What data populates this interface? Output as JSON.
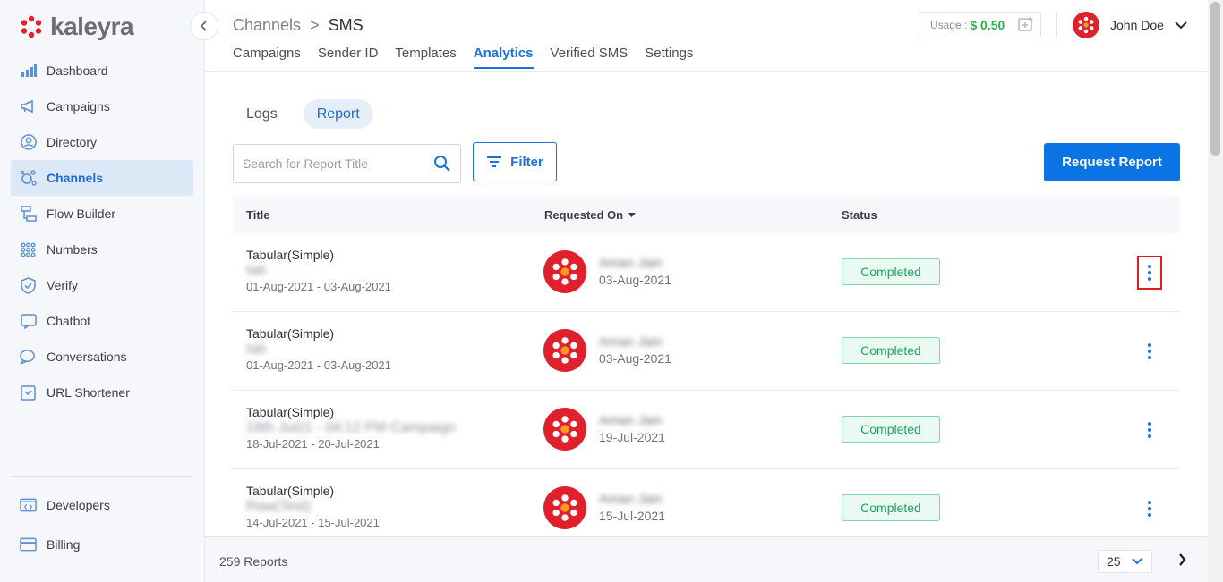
{
  "app": {
    "logo_text": "kaleyra"
  },
  "sidebar": {
    "items": [
      {
        "label": "Dashboard",
        "icon": "bar-chart-icon"
      },
      {
        "label": "Campaigns",
        "icon": "megaphone-icon"
      },
      {
        "label": "Directory",
        "icon": "contact-icon"
      },
      {
        "label": "Channels",
        "icon": "channels-icon",
        "active": true
      },
      {
        "label": "Flow Builder",
        "icon": "flow-icon"
      },
      {
        "label": "Numbers",
        "icon": "numbers-grid-icon"
      },
      {
        "label": "Verify",
        "icon": "shield-check-icon"
      },
      {
        "label": "Chatbot",
        "icon": "chatbot-icon"
      },
      {
        "label": "Conversations",
        "icon": "chat-bubbles-icon"
      },
      {
        "label": "URL Shortener",
        "icon": "link-icon"
      }
    ],
    "bottom_items": [
      {
        "label": "Developers",
        "icon": "code-icon"
      },
      {
        "label": "Billing",
        "icon": "card-icon"
      }
    ]
  },
  "header": {
    "breadcrumb": {
      "parent": "Channels",
      "separator": ">",
      "current": "SMS"
    },
    "tabs": [
      {
        "label": "Campaigns"
      },
      {
        "label": "Sender ID"
      },
      {
        "label": "Templates"
      },
      {
        "label": "Analytics",
        "active": true
      },
      {
        "label": "Verified SMS"
      },
      {
        "label": "Settings"
      }
    ],
    "usage": {
      "label": "Usage :",
      "amount": "$ 0.50"
    },
    "user": {
      "name": "John Doe"
    }
  },
  "subtabs": [
    {
      "label": "Logs"
    },
    {
      "label": "Report",
      "active": true
    }
  ],
  "search": {
    "placeholder": "Search for Report Title"
  },
  "filter_label": "Filter",
  "request_report_label": "Request Report",
  "table": {
    "columns": {
      "title": "Title",
      "requested_on": "Requested On",
      "status": "Status"
    },
    "rows": [
      {
        "type": "Tabular(Simple)",
        "name": "tab",
        "range": "01-Aug-2021 - 03-Aug-2021",
        "requester": "Aman Jain",
        "date": "03-Aug-2021",
        "status": "Completed"
      },
      {
        "type": "Tabular(Simple)",
        "name": "tab",
        "range": "01-Aug-2021 - 03-Aug-2021",
        "requester": "Aman Jain",
        "date": "03-Aug-2021",
        "status": "Completed"
      },
      {
        "type": "Tabular(Simple)",
        "name": "19th Jul21 - 04:12 PM Campaign",
        "range": "18-Jul-2021 - 20-Jul-2021",
        "requester": "Aman Jain",
        "date": "19-Jul-2021",
        "status": "Completed"
      },
      {
        "type": "Tabular(Simple)",
        "name": "Raw(Test)",
        "range": "14-Jul-2021 - 15-Jul-2021",
        "requester": "Aman Jain",
        "date": "15-Jul-2021",
        "status": "Completed"
      }
    ]
  },
  "footer": {
    "count": "259 Reports",
    "page_size": "25"
  },
  "colors": {
    "accent": "#1a73d9",
    "success": "#25a163",
    "brand_red": "#e0202c"
  }
}
